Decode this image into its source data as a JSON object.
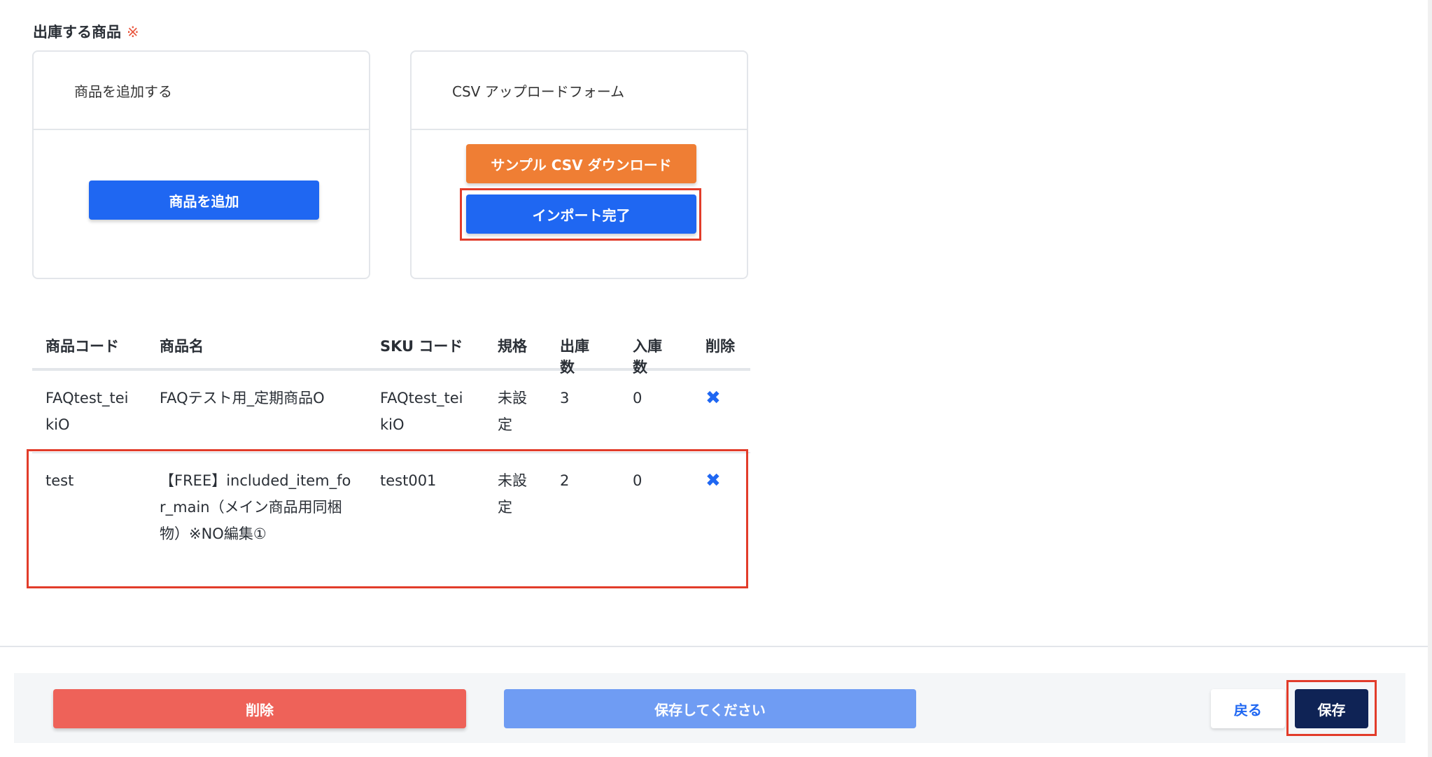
{
  "section": {
    "title": "出庫する商品",
    "required_mark": "※"
  },
  "add_card": {
    "header": "商品を追加する",
    "add_button": "商品を追加"
  },
  "csv_card": {
    "header": "CSV アップロードフォーム",
    "sample_button": "サンプル CSV ダウンロード",
    "import_button": "インポート完了"
  },
  "table": {
    "headers": [
      "商品コード",
      "商品名",
      "SKU コード",
      "規格",
      "出庫数",
      "入庫数",
      "削除"
    ],
    "rows": [
      {
        "code": "FAQtest_teikiO",
        "name": "FAQテスト用_定期商品O",
        "sku": "FAQtest_teikiO",
        "spec": "未設定",
        "out_qty": "3",
        "in_qty": "0",
        "delete_icon": "x-icon"
      },
      {
        "code": "test",
        "name": "【FREE】included_item_for_main（メイン商品用同梱物）※NO編集①",
        "sku": "test001",
        "spec": "未設定",
        "out_qty": "2",
        "in_qty": "0",
        "delete_icon": "x-icon"
      }
    ]
  },
  "footer": {
    "delete_button": "削除",
    "save_please_button": "保存してください",
    "back_button": "戻る",
    "save_button": "保存"
  },
  "colors": {
    "primary": "#1f67f2",
    "orange": "#ef7e34",
    "danger": "#ee6259",
    "navy": "#0f2355",
    "highlight": "#e23c2a"
  }
}
